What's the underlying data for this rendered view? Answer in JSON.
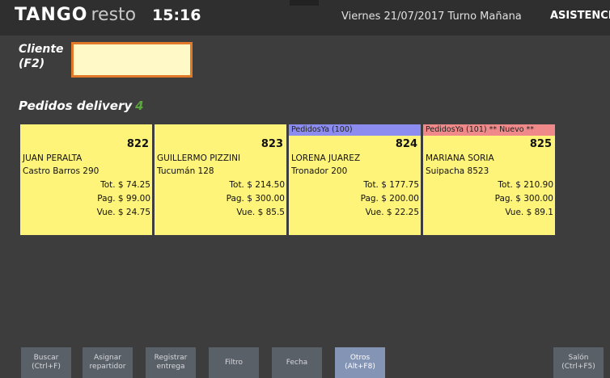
{
  "header": {
    "logo_main": "TANGO",
    "logo_sub": "resto",
    "time": "15:16",
    "datetime": "Viernes 21/07/2017 Turno Mañana",
    "mode": "ASISTENCIA"
  },
  "cliente": {
    "label_line1": "Cliente",
    "label_line2": "(F2)",
    "value": ""
  },
  "delivery": {
    "title": "Pedidos delivery",
    "count": "4"
  },
  "orders": [
    {
      "header": "",
      "header_color": "#fff47a",
      "number": "822",
      "name": "JUAN PERALTA",
      "address": "Castro Barros 290",
      "total": "Tot. $ 74.25",
      "paid": "Pag. $ 99.00",
      "change": "Vue. $ 24.75"
    },
    {
      "header": "",
      "header_color": "#fff47a",
      "number": "823",
      "name": "GUILLERMO PIZZINI",
      "address": "Tucumán 128",
      "total": "Tot. $ 214.50",
      "paid": "Pag. $ 300.00",
      "change": "Vue. $ 85.5"
    },
    {
      "header": "PedidosYa (100)",
      "header_color": "#8c8cf0",
      "number": "824",
      "name": "LORENA JUAREZ",
      "address": "Tronador 200",
      "total": "Tot. $ 177.75",
      "paid": "Pag. $ 200.00",
      "change": "Vue. $ 22.25"
    },
    {
      "header": "PedidosYa (101) ** Nuevo **",
      "header_color": "#f08a8a",
      "number": "825",
      "name": "MARIANA SORIA",
      "address": "Suipacha 8523",
      "total": "Tot. $ 210.90",
      "paid": "Pag. $ 300.00",
      "change": "Vue. $ 89.1"
    }
  ],
  "toolbar": {
    "buscar_l1": "Buscar",
    "buscar_l2": "(Ctrl+F)",
    "asignar_l1": "Asignar",
    "asignar_l2": "repartidor",
    "registrar_l1": "Registrar",
    "registrar_l2": "entrega",
    "filtro": "Filtro",
    "fecha": "Fecha",
    "otros_l1": "Otros",
    "otros_l2": "(Alt+F8)",
    "salon_l1": "Salón",
    "salon_l2": "(Ctrl+F5)"
  }
}
